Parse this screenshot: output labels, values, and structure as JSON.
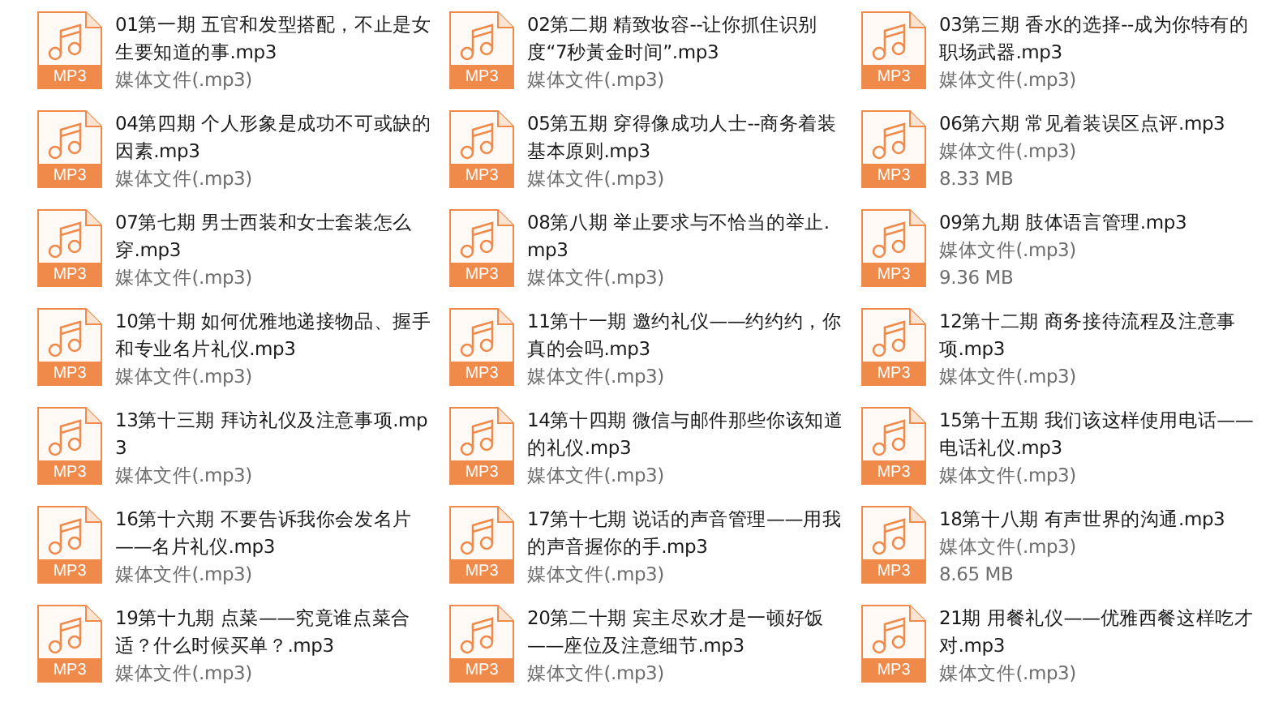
{
  "files": [
    {
      "name": "01第一期 五官和发型搭配，不止是女生要知道的事.mp3",
      "type": "媒体文件(.mp3)",
      "badge": "MP3"
    },
    {
      "name": "02第二期 精致妆容--让你抓住识别度“7秒黃金时间”.mp3",
      "type": "媒体文件(.mp3)",
      "badge": "MP3"
    },
    {
      "name": "03第三期 香水的选择--成为你特有的职场武器.mp3",
      "type": "媒体文件(.mp3)",
      "badge": "MP3"
    },
    {
      "name": "04第四期 个人形象是成功不可或缺的因素.mp3",
      "type": "媒体文件(.mp3)",
      "badge": "MP3"
    },
    {
      "name": "05第五期 穿得像成功人士--商务着装基本原则.mp3",
      "type": "媒体文件(.mp3)",
      "badge": "MP3"
    },
    {
      "name": "06第六期 常见着装误区点评.mp3",
      "type": "媒体文件(.mp3)",
      "size": "8.33 MB",
      "badge": "MP3"
    },
    {
      "name": "07第七期 男士西装和女士套装怎么穿.mp3",
      "type": "媒体文件(.mp3)",
      "badge": "MP3"
    },
    {
      "name": "08第八期 举止要求与不恰当的举止.mp3",
      "type": "媒体文件(.mp3)",
      "badge": "MP3"
    },
    {
      "name": "09第九期 肢体语言管理.mp3",
      "type": "媒体文件(.mp3)",
      "size": "9.36 MB",
      "badge": "MP3"
    },
    {
      "name": "10第十期 如何优雅地递接物品、握手和专业名片礼仪.mp3",
      "type": "媒体文件(.mp3)",
      "badge": "MP3"
    },
    {
      "name": "11第十一期 邀约礼仪——约约约，你真的会吗.mp3",
      "type": "媒体文件(.mp3)",
      "badge": "MP3"
    },
    {
      "name": "12第十二期 商务接待流程及注意事项.mp3",
      "type": "媒体文件(.mp3)",
      "badge": "MP3"
    },
    {
      "name": "13第十三期 拜访礼仪及注意事项.mp3",
      "type": "媒体文件(.mp3)",
      "badge": "MP3"
    },
    {
      "name": "14第十四期 微信与邮件那些你该知道的礼仪.mp3",
      "type": "媒体文件(.mp3)",
      "badge": "MP3"
    },
    {
      "name": "15第十五期 我们该这样使用电话——电话礼仪.mp3",
      "type": "媒体文件(.mp3)",
      "badge": "MP3"
    },
    {
      "name": "16第十六期 不要告诉我你会发名片——名片礼仪.mp3",
      "type": "媒体文件(.mp3)",
      "badge": "MP3"
    },
    {
      "name": "17第十七期 说话的声音管理——用我的声音握你的手.mp3",
      "type": "媒体文件(.mp3)",
      "badge": "MP3"
    },
    {
      "name": "18第十八期 有声世界的沟通.mp3",
      "type": "媒体文件(.mp3)",
      "size": "8.65 MB",
      "badge": "MP3"
    },
    {
      "name": "19第十九期 点菜——究竟谁点菜合适？什么时候买单？.mp3",
      "type": "媒体文件(.mp3)",
      "badge": "MP3"
    },
    {
      "name": "20第二十期 宾主尽欢才是一顿好饭——座位及注意细节.mp3",
      "type": "媒体文件(.mp3)",
      "badge": "MP3"
    },
    {
      "name": "21期 用餐礼仪——优雅西餐这样吃才对.mp3",
      "type": "媒体文件(.mp3)",
      "badge": "MP3"
    }
  ]
}
